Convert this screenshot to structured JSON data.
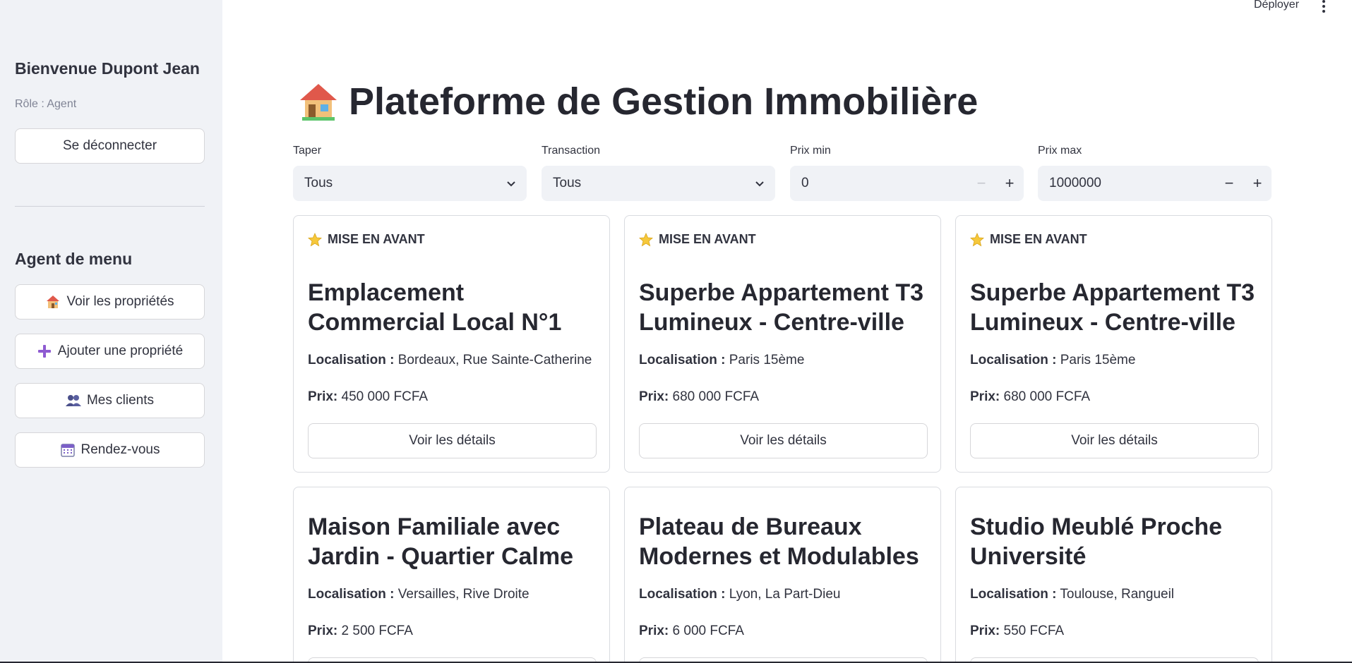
{
  "sidebar": {
    "welcome": "Bienvenue Dupont Jean",
    "role": "Rôle : Agent",
    "logout_label": "Se déconnecter",
    "menu_title": "Agent de menu",
    "items": [
      {
        "label": "Voir les propriétés",
        "icon": "house-icon"
      },
      {
        "label": "Ajouter une propriété",
        "icon": "plus-icon"
      },
      {
        "label": "Mes clients",
        "icon": "people-icon"
      },
      {
        "label": "Rendez-vous",
        "icon": "calendar-icon"
      }
    ]
  },
  "header": {
    "deploy_label": "Déployer"
  },
  "main": {
    "title": "Plateforme de Gestion Immobilière",
    "filters": {
      "type_label": "Taper",
      "type_value": "Tous",
      "transaction_label": "Transaction",
      "transaction_value": "Tous",
      "min_label": "Prix min",
      "min_value": "0",
      "max_label": "Prix max",
      "max_value": "1000000"
    },
    "featured_label": "MISE EN AVANT",
    "location_label": "Localisation :",
    "price_label": "Prix:",
    "details_label": "Voir les détails",
    "cards": [
      {
        "title": "Emplacement Commercial Local N°1",
        "location": "Bordeaux, Rue Sainte-Catherine",
        "price": "450 000 FCFA",
        "featured": true
      },
      {
        "title": "Superbe Appartement T3 Lumineux - Centre-ville",
        "location": "Paris 15ème",
        "price": "680 000 FCFA",
        "featured": true
      },
      {
        "title": "Superbe Appartement T3 Lumineux - Centre-ville",
        "location": "Paris 15ème",
        "price": "680 000 FCFA",
        "featured": true
      },
      {
        "title": "Maison Familiale avec Jardin - Quartier Calme",
        "location": "Versailles, Rive Droite",
        "price": "2 500 FCFA",
        "featured": false
      },
      {
        "title": "Plateau de Bureaux Modernes et Modulables",
        "location": "Lyon, La Part-Dieu",
        "price": "6 000 FCFA",
        "featured": false
      },
      {
        "title": "Studio Meublé Proche Université",
        "location": "Toulouse, Rangueil",
        "price": "550 FCFA",
        "featured": false
      }
    ]
  },
  "colors": {
    "sidebar_bg": "#f0f2f6",
    "text": "#31333f",
    "star": "#f6c83b"
  }
}
